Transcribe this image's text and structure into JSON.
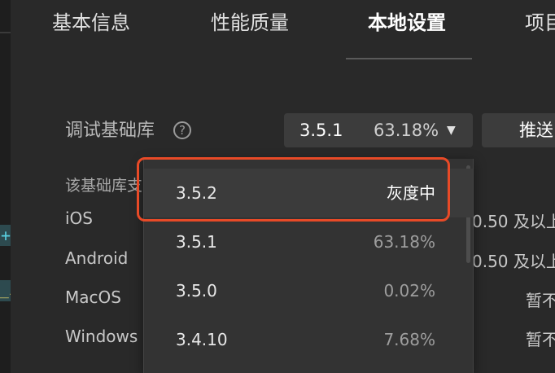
{
  "tabs": [
    {
      "label": "基本信息"
    },
    {
      "label": "性能质量"
    },
    {
      "label": "本地设置"
    },
    {
      "label": "项目"
    }
  ],
  "left_strip": {
    "glyph_1": "+",
    "glyph_2": "_i"
  },
  "debug_lib": {
    "label": "调试基础库",
    "help_icon": "?",
    "selected_version": "3.5.1",
    "selected_percent": "63.18%",
    "caret": "▼",
    "push_label": "推送"
  },
  "support": {
    "heading": "该基础库支",
    "platforms": [
      {
        "name": "iOS",
        "requirement": "0.50 及以上"
      },
      {
        "name": "Android",
        "requirement": "0.50 及以上"
      },
      {
        "name": "MacOS",
        "requirement": "暂不"
      },
      {
        "name": "Windows",
        "requirement": "暂不"
      }
    ]
  },
  "dropdown": {
    "options": [
      {
        "version": "3.5.2",
        "status": "灰度中"
      },
      {
        "version": "3.5.1",
        "status": "63.18%"
      },
      {
        "version": "3.5.0",
        "status": "0.02%"
      },
      {
        "version": "3.4.10",
        "status": "7.68%"
      }
    ]
  },
  "colors": {
    "highlight_border": "#e84a27",
    "background": "#292929"
  }
}
